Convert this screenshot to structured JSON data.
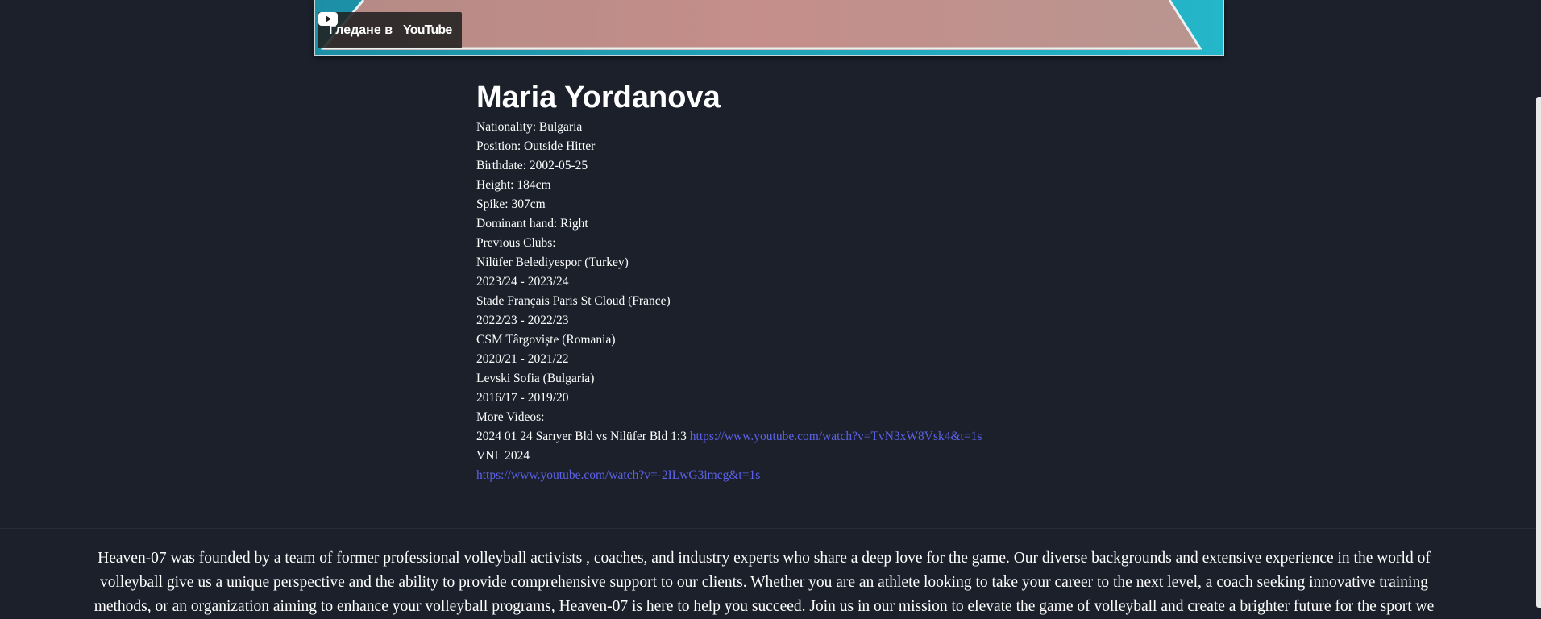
{
  "video": {
    "watch_label": "Гледане в",
    "brand": "YouTube"
  },
  "player": {
    "name": "Maria Yordanova",
    "nationality": "Nationality: Bulgaria",
    "position": "Position: Outside Hitter",
    "birthdate": "Birthdate: 2002-05-25",
    "height": "Height: 184cm",
    "spike": "Spike: 307cm",
    "dominant_hand": "Dominant hand: Right",
    "previous_clubs_label": "Previous Clubs:",
    "clubs": [
      {
        "name": "Nilüfer Belediyespor (Turkey)",
        "seasons": "2023/24 - 2023/24"
      },
      {
        "name": "Stade Français Paris St Cloud (France)",
        "seasons": "2022/23 - 2022/23"
      },
      {
        "name": "CSM Târgoviște (Romania)",
        "seasons": "2020/21 - 2021/22"
      },
      {
        "name": "Levski Sofia (Bulgaria)",
        "seasons": "2016/17 - 2019/20"
      }
    ],
    "more_videos_label": "More Videos:",
    "videos": [
      {
        "title": "2024 01 24 Sarıyer Bld vs Nilüfer Bld 1:3",
        "url": "https://www.youtube.com/watch?v=TvN3xW8Vsk4&t=1s"
      },
      {
        "title": "VNL 2024",
        "url": "https://www.youtube.com/watch?v=-2ILwG3imcg&t=1s"
      }
    ]
  },
  "about": {
    "text": "Heaven-07 was founded by a team of former professional volleyball activists , coaches, and industry experts who share a deep love for the game. Our diverse backgrounds and extensive experience in the world of volleyball give us a unique perspective and the ability to provide comprehensive support to our clients. Whether you are an athlete looking to take your career to the next level, a coach seeking innovative training methods, or an organization aiming to enhance your volleyball programs, Heaven-07 is here to help you succeed. Join us in our mission to elevate the game of volleyball and create a brighter future for the sport we"
  },
  "colors": {
    "background": "#1b202b",
    "text": "#ffffff",
    "link": "#5c62e8",
    "court": "#c48b87",
    "court_outer": "#2a9fb6"
  }
}
